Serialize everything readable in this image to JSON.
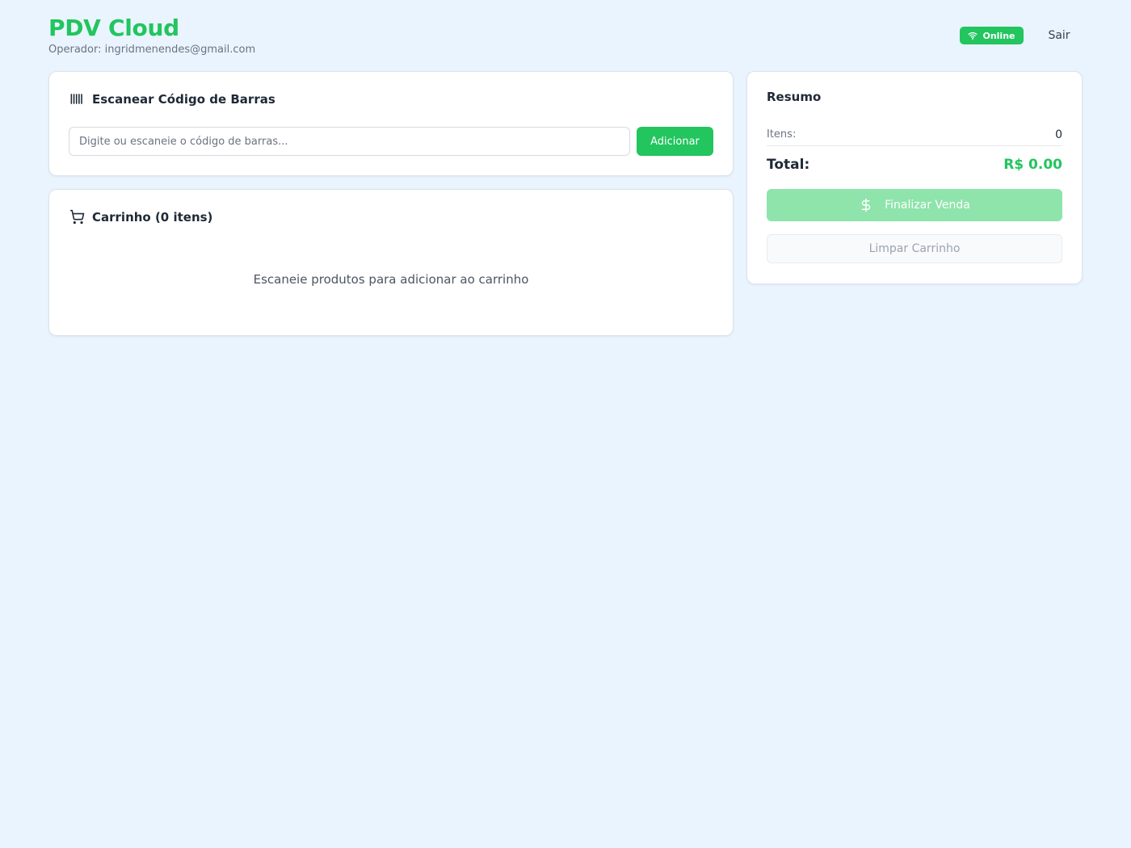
{
  "header": {
    "app_title": "PDV Cloud",
    "operator_text": "Operador: ingridmenendes@gmail.com",
    "status_badge": "Online",
    "logout_label": "Sair"
  },
  "scanner": {
    "title": "Escanear Código de Barras",
    "input_placeholder": "Digite ou escaneie o código de barras...",
    "input_value": "",
    "add_label": "Adicionar"
  },
  "cart": {
    "title": "Carrinho (0 itens)",
    "empty_message": "Escaneie produtos para adicionar ao carrinho"
  },
  "summary": {
    "title": "Resumo",
    "items_label": "Itens:",
    "items_count": "0",
    "total_label": "Total:",
    "total_value": "R$ 0.00",
    "finalize_label": "Finalizar Venda",
    "clear_label": "Limpar Carrinho"
  },
  "colors": {
    "accent": "#22c55e",
    "accent_disabled": "#8ee4ab",
    "background": "#eaf4ff"
  },
  "icons": {
    "online": "wifi-icon",
    "scanner": "barcode-icon",
    "cart": "shopping-cart-icon",
    "finalize": "dollar-icon"
  }
}
